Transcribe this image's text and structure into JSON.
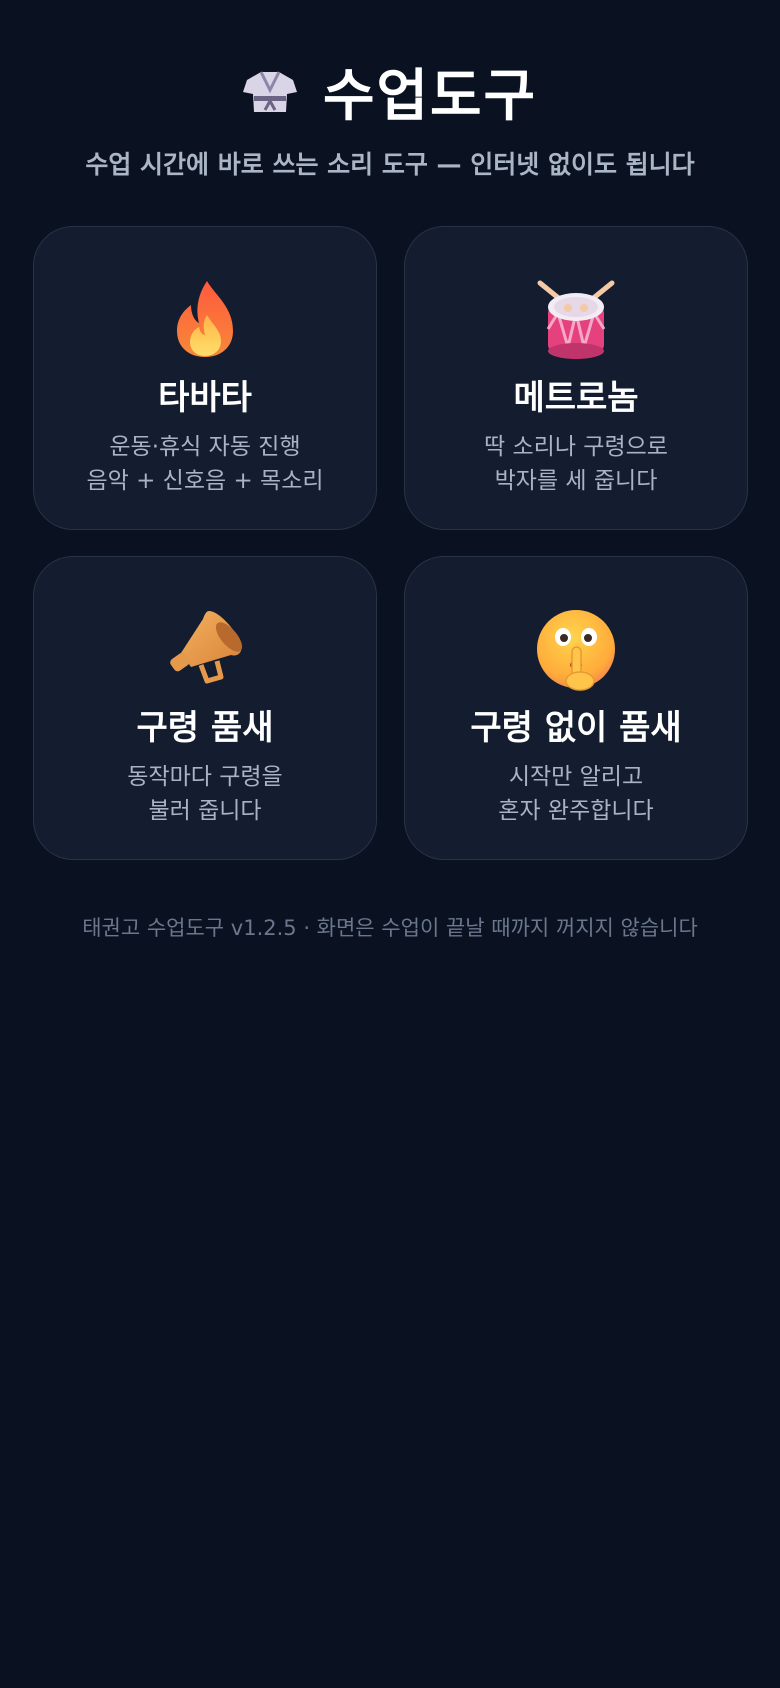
{
  "header": {
    "icon": "dobok-icon",
    "title": "수업도구",
    "subtitle": "수업 시간에 바로 쓰는 소리 도구 — 인터넷 없이도 됩니다"
  },
  "cards": [
    {
      "icon": "fire-icon",
      "title": "타바타",
      "desc_line1": "운동·휴식 자동 진행",
      "desc_line2": "음악 + 신호음 + 목소리"
    },
    {
      "icon": "drum-icon",
      "title": "메트로놈",
      "desc_line1": "딱 소리나 구령으로",
      "desc_line2": "박자를 세 줍니다"
    },
    {
      "icon": "megaphone-icon",
      "title": "구령 품새",
      "desc_line1": "동작마다 구령을",
      "desc_line2": "불러 줍니다"
    },
    {
      "icon": "shushing-face-icon",
      "title": "구령 없이 품새",
      "desc_line1": "시작만 알리고",
      "desc_line2": "혼자 완주합니다"
    }
  ],
  "footer": {
    "text": "태권고 수업도구 v1.2.5 · 화면은 수업이 끝날 때까지 꺼지지 않습니다"
  },
  "colors": {
    "background": "#0a1120",
    "card": "#141d2f",
    "card_border": "#283347",
    "subtitle": "#aab5c6",
    "footer": "#6a778d"
  }
}
